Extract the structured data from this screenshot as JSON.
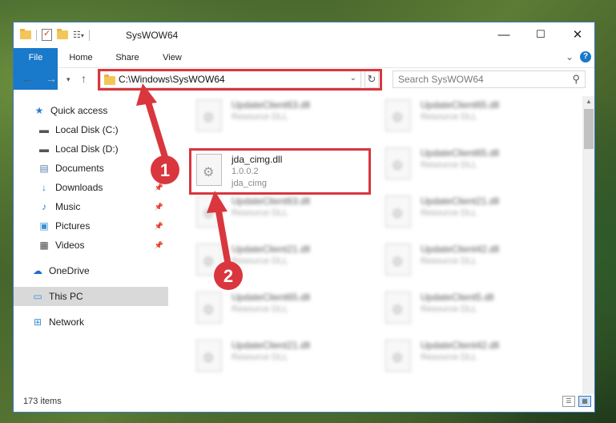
{
  "window": {
    "title": "SysWOW64",
    "controls": {
      "minimize": "—",
      "maximize": "☐",
      "close": "✕"
    }
  },
  "ribbon": {
    "tabs": [
      "File",
      "Home",
      "Share",
      "View"
    ],
    "help": "?",
    "expand": "⌄"
  },
  "address": {
    "path": "C:\\Windows\\SysWOW64",
    "refresh": "↻"
  },
  "search": {
    "placeholder": "Search SysWOW64",
    "icon": "search-icon"
  },
  "sidebar": {
    "items": [
      {
        "label": "Quick access",
        "icon": "star-icon"
      },
      {
        "label": "Local Disk (C:)",
        "icon": "drive-icon"
      },
      {
        "label": "Local Disk (D:)",
        "icon": "drive-icon"
      },
      {
        "label": "Documents",
        "icon": "documents-icon"
      },
      {
        "label": "Downloads",
        "icon": "downloads-icon"
      },
      {
        "label": "Music",
        "icon": "music-icon"
      },
      {
        "label": "Pictures",
        "icon": "pictures-icon"
      },
      {
        "label": "Videos",
        "icon": "videos-icon"
      },
      {
        "label": "OneDrive",
        "icon": "onedrive-icon"
      },
      {
        "label": "This PC",
        "icon": "pc-icon"
      },
      {
        "label": "Network",
        "icon": "network-icon"
      }
    ]
  },
  "files": {
    "col1": [
      {
        "name": "UpdateClient63.dll",
        "type": "Resource DLL"
      },
      {
        "name": "jda_cimg.dll",
        "version": "1.0.0.2",
        "description": "jda_cimg"
      },
      {
        "name": "UpdateClient63.dll",
        "type": "Resource DLL"
      },
      {
        "name": "UpdateClient21.dll",
        "type": "Resource DLL"
      },
      {
        "name": "UpdateClient65.dll",
        "type": "Resource DLL"
      },
      {
        "name": "UpdateClient21.dll",
        "type": "Resource DLL"
      }
    ],
    "col2": [
      {
        "name": "UpdateClient65.dll",
        "type": "Resource DLL"
      },
      {
        "name": "UpdateClient65.dll",
        "type": "Resource DLL"
      },
      {
        "name": "UpdateClient21.dll",
        "type": "Resource DLL"
      },
      {
        "name": "UpdateClient42.dll",
        "type": "Resource DLL"
      },
      {
        "name": "UpdateClient5.dll",
        "type": "Resource DLL"
      },
      {
        "name": "UpdateClient42.dll",
        "type": "Resource DLL"
      }
    ]
  },
  "status": {
    "count": "173 items"
  },
  "annotations": {
    "step1": "1",
    "step2": "2",
    "color": "#d9363e"
  }
}
